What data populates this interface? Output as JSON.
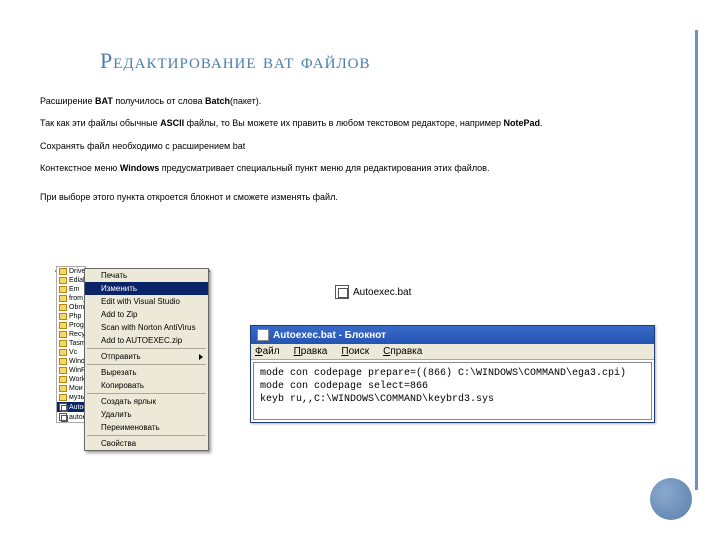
{
  "title": "Редактирование bat файлов",
  "para": {
    "p1a": "Расширение ",
    "p1b": "BAT",
    "p1c": " получилось от слова ",
    "p1d": "Batch",
    "p1e": "(пакет).",
    "p2a": "Так как эти файлы обычные ",
    "p2b": "ASCII",
    "p2c": " файлы, то Вы можете их править в любом текстовом редакторе, например ",
    "p2d": "NotePad",
    "p2e": ".",
    "p3": "Сохранять файл необходимо с расширением bat",
    "p4a": "Контекстное меню ",
    "p4b": "Windows",
    "p4c": " предусматривает специальный пункт меню для редактирования этих файлов.",
    "p5": "При выборе этого пункта откроется блокнот и сможете изменять файл."
  },
  "file_list": [
    "Driver",
    "Edialer",
    "Em",
    "from_se",
    "Obmen",
    "Php",
    "Program",
    "Recycle",
    "Tasm50",
    "Vc",
    "Windo",
    "WinRA",
    "Work",
    "Мои до",
    "музык",
    "Autoexec.bat",
    "autoexec.nav"
  ],
  "file_list_selected": 15,
  "context_menu": {
    "items": [
      {
        "label": "Печать",
        "sep": false
      },
      {
        "label": "Изменить",
        "sel": true
      },
      {
        "label": "Edit with Visual Studio"
      },
      {
        "label": "Add to Zip"
      },
      {
        "label": "Scan with Norton AntiVirus"
      },
      {
        "label": "Add to AUTOEXEC.zip"
      },
      {
        "sep": true
      },
      {
        "label": "Отправить",
        "arrow": true
      },
      {
        "sep": true
      },
      {
        "label": "Вырезать"
      },
      {
        "label": "Копировать"
      },
      {
        "sep": true
      },
      {
        "label": "Создать ярлык"
      },
      {
        "label": "Удалить"
      },
      {
        "label": "Переименовать"
      },
      {
        "sep": true
      },
      {
        "label": "Свойства"
      }
    ]
  },
  "autoexec_label": "Autoexec.bat",
  "notepad": {
    "title": "Autoexec.bat - Блокнот",
    "menus": [
      "Файл",
      "Правка",
      "Поиск",
      "Справка"
    ],
    "content": "mode con codepage prepare=((866) C:\\WINDOWS\\COMMAND\\ega3.cpi)\nmode con codepage select=866\nkeyb ru,,C:\\WINDOWS\\COMMAND\\keybrd3.sys"
  }
}
